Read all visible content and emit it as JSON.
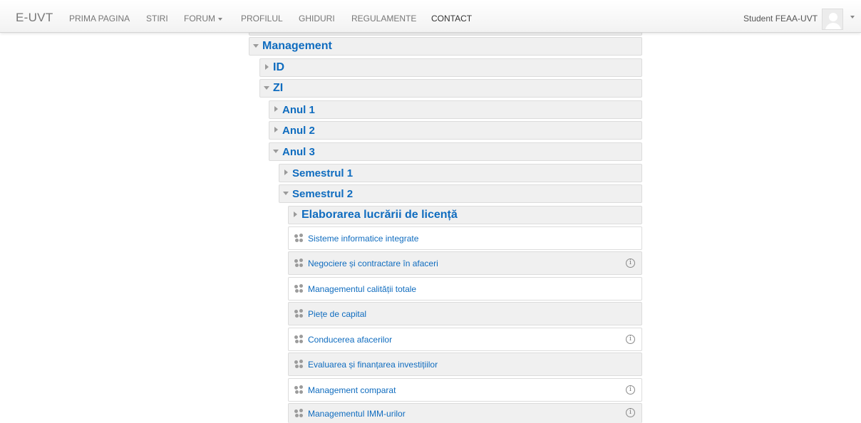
{
  "navbar": {
    "brand": "E-UVT",
    "links": [
      "PRIMA PAGINA",
      "STIRI",
      "FORUM",
      "PROFILUL",
      "GHIDURI",
      "REGULAMENTE",
      "CONTACT"
    ],
    "user_name": "Student FEAA-UVT"
  },
  "tree": {
    "management": "Management",
    "id": "ID",
    "zi": "ZI",
    "anul1": "Anul 1",
    "anul2": "Anul 2",
    "anul3": "Anul 3",
    "sem1": "Semestrul 1",
    "sem2": "Semestrul 2",
    "elaborare": "Elaborarea lucrării de licență",
    "courses": [
      "Sisteme informatice integrate",
      "Negociere și contractare în afaceri",
      "Managementul calității totale",
      "Piețe de capital",
      "Conducerea afacerilor",
      "Evaluarea și finanțarea investițiilor",
      "Management comparat",
      "Managementul IMM-urilor"
    ],
    "info_symbol": "i"
  },
  "colors": {
    "link": "#0f6cbf",
    "row_alt": "#f0f0f0",
    "border": "#dcdcdc"
  }
}
